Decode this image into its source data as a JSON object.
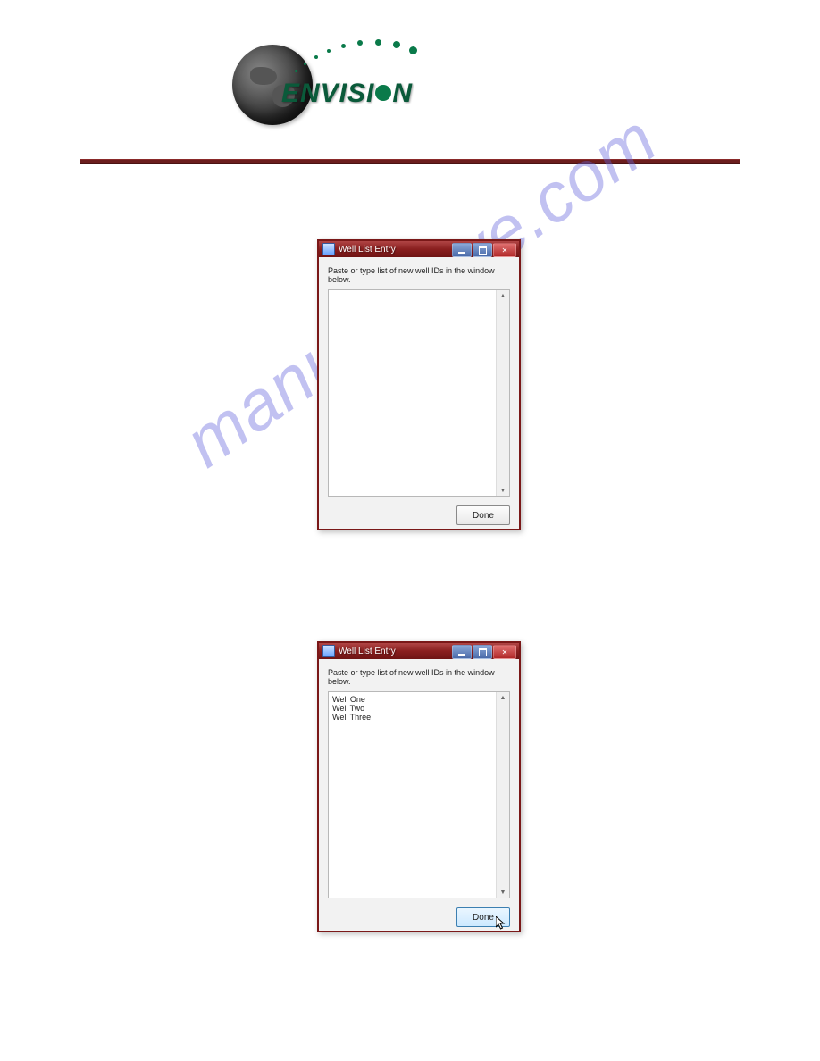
{
  "logo": {
    "brand_text": "ENVISI",
    "brand_suffix": "N"
  },
  "watermark": "manualshive.com",
  "dialog1": {
    "title": "Well List Entry",
    "instruction": "Paste or type list of new well IDs in the window below.",
    "textarea_value": "",
    "done_label": "Done"
  },
  "dialog2": {
    "title": "Well List Entry",
    "instruction": "Paste or type list of new well IDs in the window below.",
    "textarea_value": "Well One\nWell Two\nWell Three",
    "done_label": "Done"
  }
}
